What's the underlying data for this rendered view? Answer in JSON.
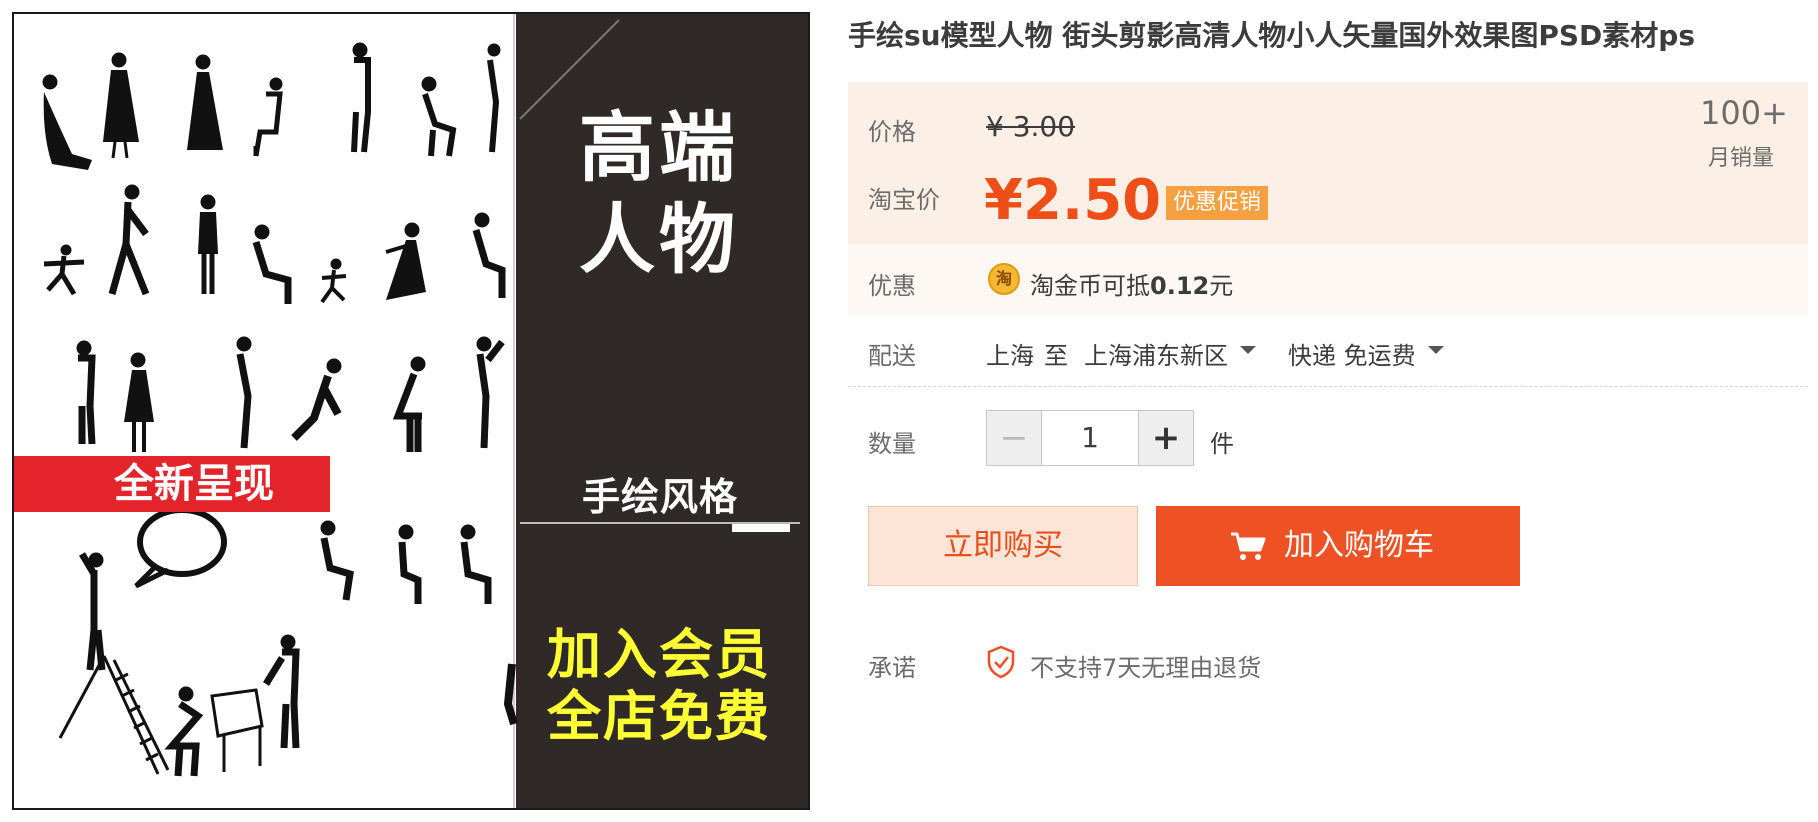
{
  "product_image": {
    "headline_line1": "高端",
    "headline_line2": "人物",
    "style_text": "手绘风格",
    "member_line1": "加入会员",
    "member_line2": "全店免费",
    "banner_text": "全新呈现"
  },
  "product": {
    "title": "手绘su模型人物 街头剪影高清人物小人矢量国外效果图PSD素材ps"
  },
  "price": {
    "price_label": "价格",
    "original_price": "¥ 3.00",
    "taobao_price_label": "淘宝价",
    "current_price": "¥2.50",
    "promo_tag": "优惠促销",
    "monthly_sales_count": "100+",
    "monthly_sales_label": "月销量"
  },
  "discount": {
    "label": "优惠",
    "coin_glyph": "淘",
    "text_prefix": "淘金币可抵",
    "amount": "0.12",
    "text_suffix": "元"
  },
  "shipping": {
    "label": "配送",
    "from": "上海",
    "to_word": "至",
    "destination": "上海浦东新区",
    "method": "快递 免运费"
  },
  "quantity": {
    "label": "数量",
    "minus": "−",
    "value": "1",
    "plus": "+",
    "unit": "件"
  },
  "actions": {
    "buy_now": "立即购买",
    "add_to_cart": "加入购物车"
  },
  "promise": {
    "label": "承诺",
    "text": "不支持7天无理由退货"
  },
  "colors": {
    "accent_orange": "#ee5124",
    "price_red": "#ee4f18",
    "promo_tag_bg": "#f6a042",
    "price_box_bg": "#fcf0e6",
    "image_dark_panel": "#2f2a28",
    "member_text_yellow": "#ffff33",
    "banner_red": "#e3242b"
  },
  "icons": [
    "search-zoom-icon",
    "coin-icon",
    "caret-down-icon",
    "cart-icon",
    "shield-check-icon"
  ]
}
